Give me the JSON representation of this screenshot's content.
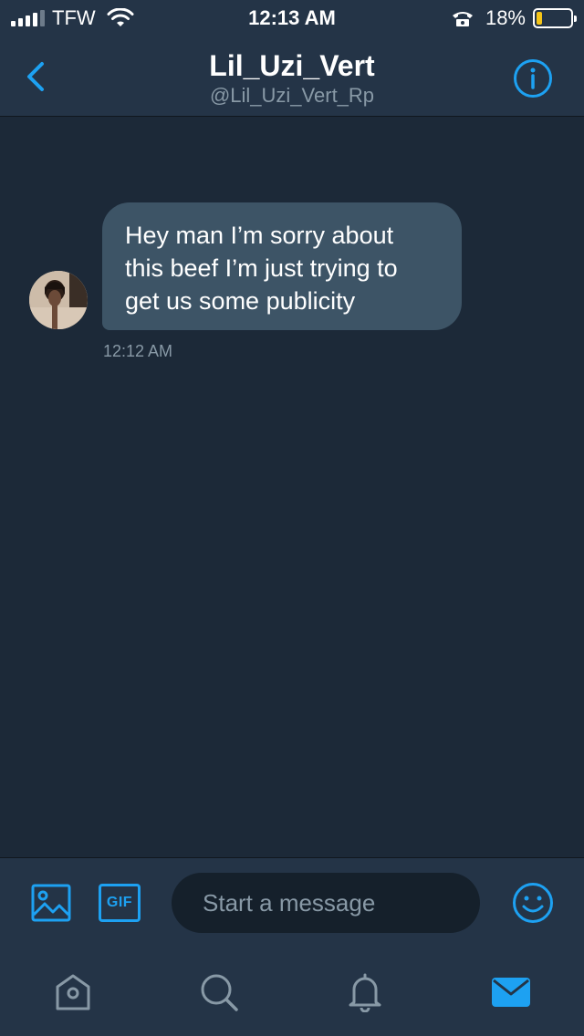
{
  "status_bar": {
    "carrier": "TFW",
    "time": "12:13 AM",
    "battery_percent": "18%",
    "battery_level": 0.18,
    "signal_bars": 4,
    "icons": [
      "signal-icon",
      "wifi-icon",
      "phone-icon",
      "battery-icon"
    ]
  },
  "header": {
    "title": "Lil_Uzi_Vert",
    "handle": "@Lil_Uzi_Vert_Rp",
    "back_icon": "chevron-left-icon",
    "info_icon": "info-icon"
  },
  "conversation": {
    "messages": [
      {
        "text": "Hey man I’m sorry about this beef I’m just trying to get us some publicity",
        "lines": [
          "Hey man I’m sorry about",
          "this beef I’m just trying to",
          "get us some publicity"
        ],
        "time": "12:12 AM",
        "direction": "incoming"
      }
    ]
  },
  "composer": {
    "placeholder": "Start a message",
    "gif_label": "GIF",
    "icons": [
      "image-icon",
      "gif-icon",
      "emoji-icon"
    ]
  },
  "tabbar": {
    "tabs": [
      {
        "icon": "home-icon",
        "active": false
      },
      {
        "icon": "search-icon",
        "active": false
      },
      {
        "icon": "bell-icon",
        "active": false
      },
      {
        "icon": "mail-icon",
        "active": true
      }
    ]
  },
  "colors": {
    "background": "#1c2938",
    "bar": "#243447",
    "accent": "#1da1f2",
    "bubble": "#3d5466",
    "muted_text": "#8899a6",
    "input_bg": "#15202b",
    "battery_fill": "#f5c518"
  }
}
